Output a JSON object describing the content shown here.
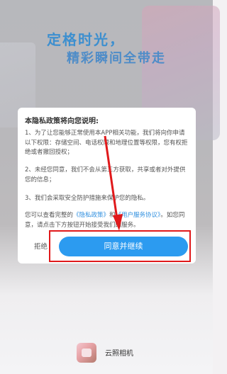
{
  "splash": {
    "headline_1": "定格时光，",
    "headline_2": "精彩瞬间全带走"
  },
  "dialog": {
    "title": "本隐私政策将向您说明:",
    "p1": "1、为了让您能够正常使用本APP相关功能，我们将向你申请以下权限：存储空间、电话权限和地理位置等权限，您有权拒绝或者撤回授权；",
    "p2": "2、未经您同意，我们不会从第三方获取，共享或者对外提供您的信息；",
    "p3": "3、我们会采取安全防护措施来保护您的隐私。",
    "p4_prefix": "您可以查看完整的",
    "privacy_link": "《隐私政策》",
    "p4_and": "和",
    "terms_link": "《用户服务协议》",
    "p4_suffix": "。如您同意，请点击下方按钮开始接受我们的服务。",
    "reject_label": "拒绝",
    "agree_label": "同意并继续"
  },
  "app": {
    "name": "云照相机",
    "icon": "app-icon"
  },
  "colors": {
    "accent": "#2c9bf0",
    "annotation": "#e0191b",
    "headline": "#3d8fcf"
  }
}
